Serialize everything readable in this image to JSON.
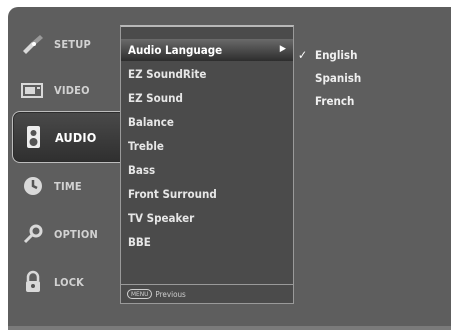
{
  "sidebar": {
    "tabs": [
      {
        "label": "SETUP",
        "icon": "setup-satellite-icon"
      },
      {
        "label": "VIDEO",
        "icon": "video-tv-icon"
      },
      {
        "label": "AUDIO",
        "icon": "audio-speaker-icon",
        "active": true
      },
      {
        "label": "TIME",
        "icon": "time-clock-icon"
      },
      {
        "label": "OPTION",
        "icon": "option-gear-icon"
      },
      {
        "label": "LOCK",
        "icon": "lock-icon"
      }
    ]
  },
  "menu": {
    "items": [
      {
        "label": "Audio Language",
        "selected": true,
        "arrow": "▶"
      },
      {
        "label": "EZ SoundRite"
      },
      {
        "label": "EZ Sound"
      },
      {
        "label": "Balance"
      },
      {
        "label": "Treble"
      },
      {
        "label": "Bass"
      },
      {
        "label": "Front Surround"
      },
      {
        "label": "TV Speaker"
      },
      {
        "label": "BBE"
      }
    ],
    "footer": {
      "key": "MENU",
      "label": "Previous"
    }
  },
  "submenu": {
    "items": [
      {
        "label": "English",
        "checked": true,
        "check": "✓"
      },
      {
        "label": "Spanish"
      },
      {
        "label": "French"
      }
    ]
  },
  "colors": {
    "background": "#5e5e5e",
    "panel": "#4b4b4b",
    "active_tab": "#3a3a3a",
    "text": "#e6e6e6"
  }
}
